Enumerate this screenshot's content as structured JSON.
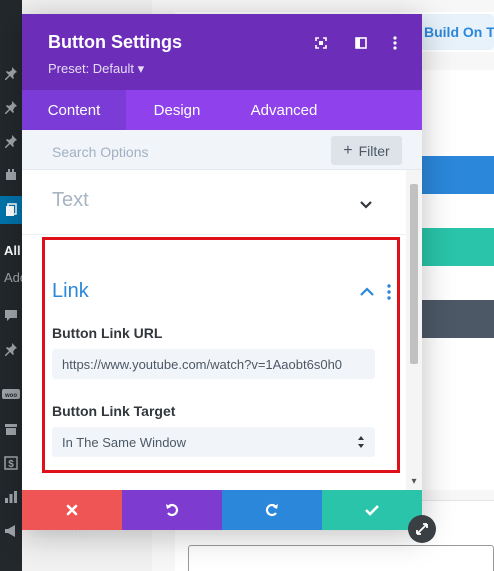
{
  "wp_sidebar": {
    "icons": [
      "pin-icon",
      "pin-icon",
      "pin-icon",
      "plugin-icon",
      "pages-icon",
      "comments-icon",
      "pin-icon",
      "woo-icon",
      "archive-icon",
      "dollar-icon",
      "chart-icon",
      "megaphone-icon"
    ],
    "active_label": "All",
    "sub_label": "Add",
    "marketing_label": "Marketing"
  },
  "background": {
    "build_button": "Build On The"
  },
  "modal": {
    "title": "Button Settings",
    "preset": "Preset: Default ▾",
    "tabs": [
      {
        "label": "Content",
        "active": true
      },
      {
        "label": "Design",
        "active": false
      },
      {
        "label": "Advanced",
        "active": false
      }
    ],
    "search": {
      "placeholder": "Search Options",
      "filter_label": "Filter"
    },
    "sections": {
      "text": {
        "title": "Text"
      },
      "link": {
        "title": "Link",
        "url_label": "Button Link URL",
        "url_value": "https://www.youtube.com/watch?v=1Aaobt6s0h0",
        "target_label": "Button Link Target",
        "target_value": "In The Same Window"
      }
    },
    "footer": [
      "discard",
      "undo",
      "redo",
      "save"
    ]
  },
  "colors": {
    "header": "#6c2eb9",
    "tabs": "#8f42ec",
    "link_accent": "#2b87da",
    "highlight": "#e0101a",
    "discard": "#ef5555",
    "undo": "#7e3bd0",
    "redo": "#2b87da",
    "save": "#29c4a9"
  }
}
